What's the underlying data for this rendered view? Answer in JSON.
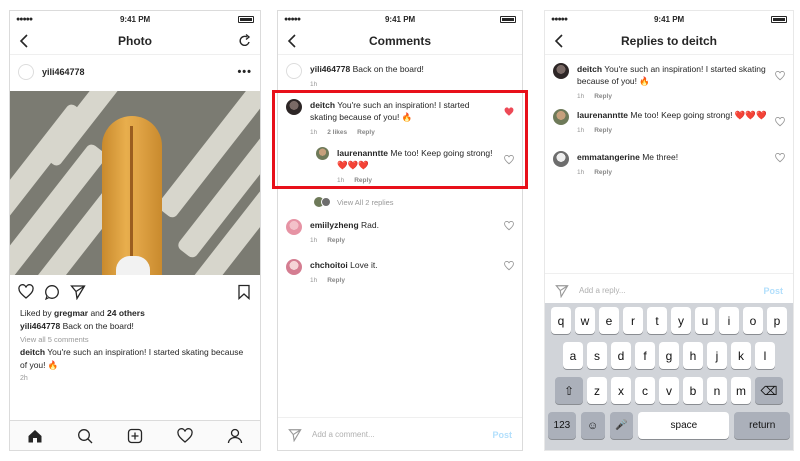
{
  "status": {
    "time": "9:41 PM",
    "signal": "●●●●●"
  },
  "screen1": {
    "title": "Photo",
    "username": "yili464778",
    "liked_by": "Liked by",
    "liked_user": "gregmar",
    "and_text": "and",
    "others": "24 others",
    "caption_user": "yili464778",
    "caption": "Back on the board!",
    "view_all": "View all 5 comments",
    "comment_user": "deitch",
    "comment": "You're such an inspiration! I started skating because of you! 🔥",
    "time": "2h"
  },
  "screen2": {
    "title": "Comments",
    "comments": [
      {
        "user": "yili464778",
        "text": "Back on the board!",
        "time": "1h"
      },
      {
        "user": "deitch",
        "text": "You're such an inspiration! I started skating because of you! 🔥",
        "time": "1h",
        "likes": "2 likes",
        "reply": "Reply"
      },
      {
        "user": "laurenanntte",
        "text": "Me too! Keep going strong! ❤️❤️❤️",
        "time": "1h",
        "reply": "Reply"
      },
      {
        "user": "emiilyzheng",
        "text": "Rad.",
        "time": "1h",
        "reply": "Reply"
      },
      {
        "user": "chchoitoi",
        "text": "Love it.",
        "time": "1h",
        "reply": "Reply"
      }
    ],
    "view_all_replies": "View All 2 replies",
    "composer_placeholder": "Add a comment...",
    "post": "Post"
  },
  "screen3": {
    "title": "Replies to deitch",
    "comments": [
      {
        "user": "deitch",
        "text": "You're such an inspiration! I started skating because of you! 🔥",
        "time": "1h",
        "reply": "Reply"
      },
      {
        "user": "laurenanntte",
        "text": "Me too! Keep going strong! ❤️❤️❤️",
        "time": "1h",
        "reply": "Reply"
      },
      {
        "user": "emmatangerine",
        "text": "Me three!",
        "time": "1h",
        "reply": "Reply"
      }
    ],
    "composer_placeholder": "Add a reply...",
    "post": "Post",
    "keyboard": {
      "row1": [
        "q",
        "w",
        "e",
        "r",
        "t",
        "y",
        "u",
        "i",
        "o",
        "p"
      ],
      "row2": [
        "a",
        "s",
        "d",
        "f",
        "g",
        "h",
        "j",
        "k",
        "l"
      ],
      "row3": [
        "z",
        "x",
        "c",
        "v",
        "b",
        "n",
        "m"
      ],
      "numbers": "123",
      "space": "space",
      "return": "return"
    }
  },
  "colors": {
    "liked_heart": "#ed4956",
    "highlight": "#e8101a",
    "post_disabled": "#b2dffc"
  }
}
